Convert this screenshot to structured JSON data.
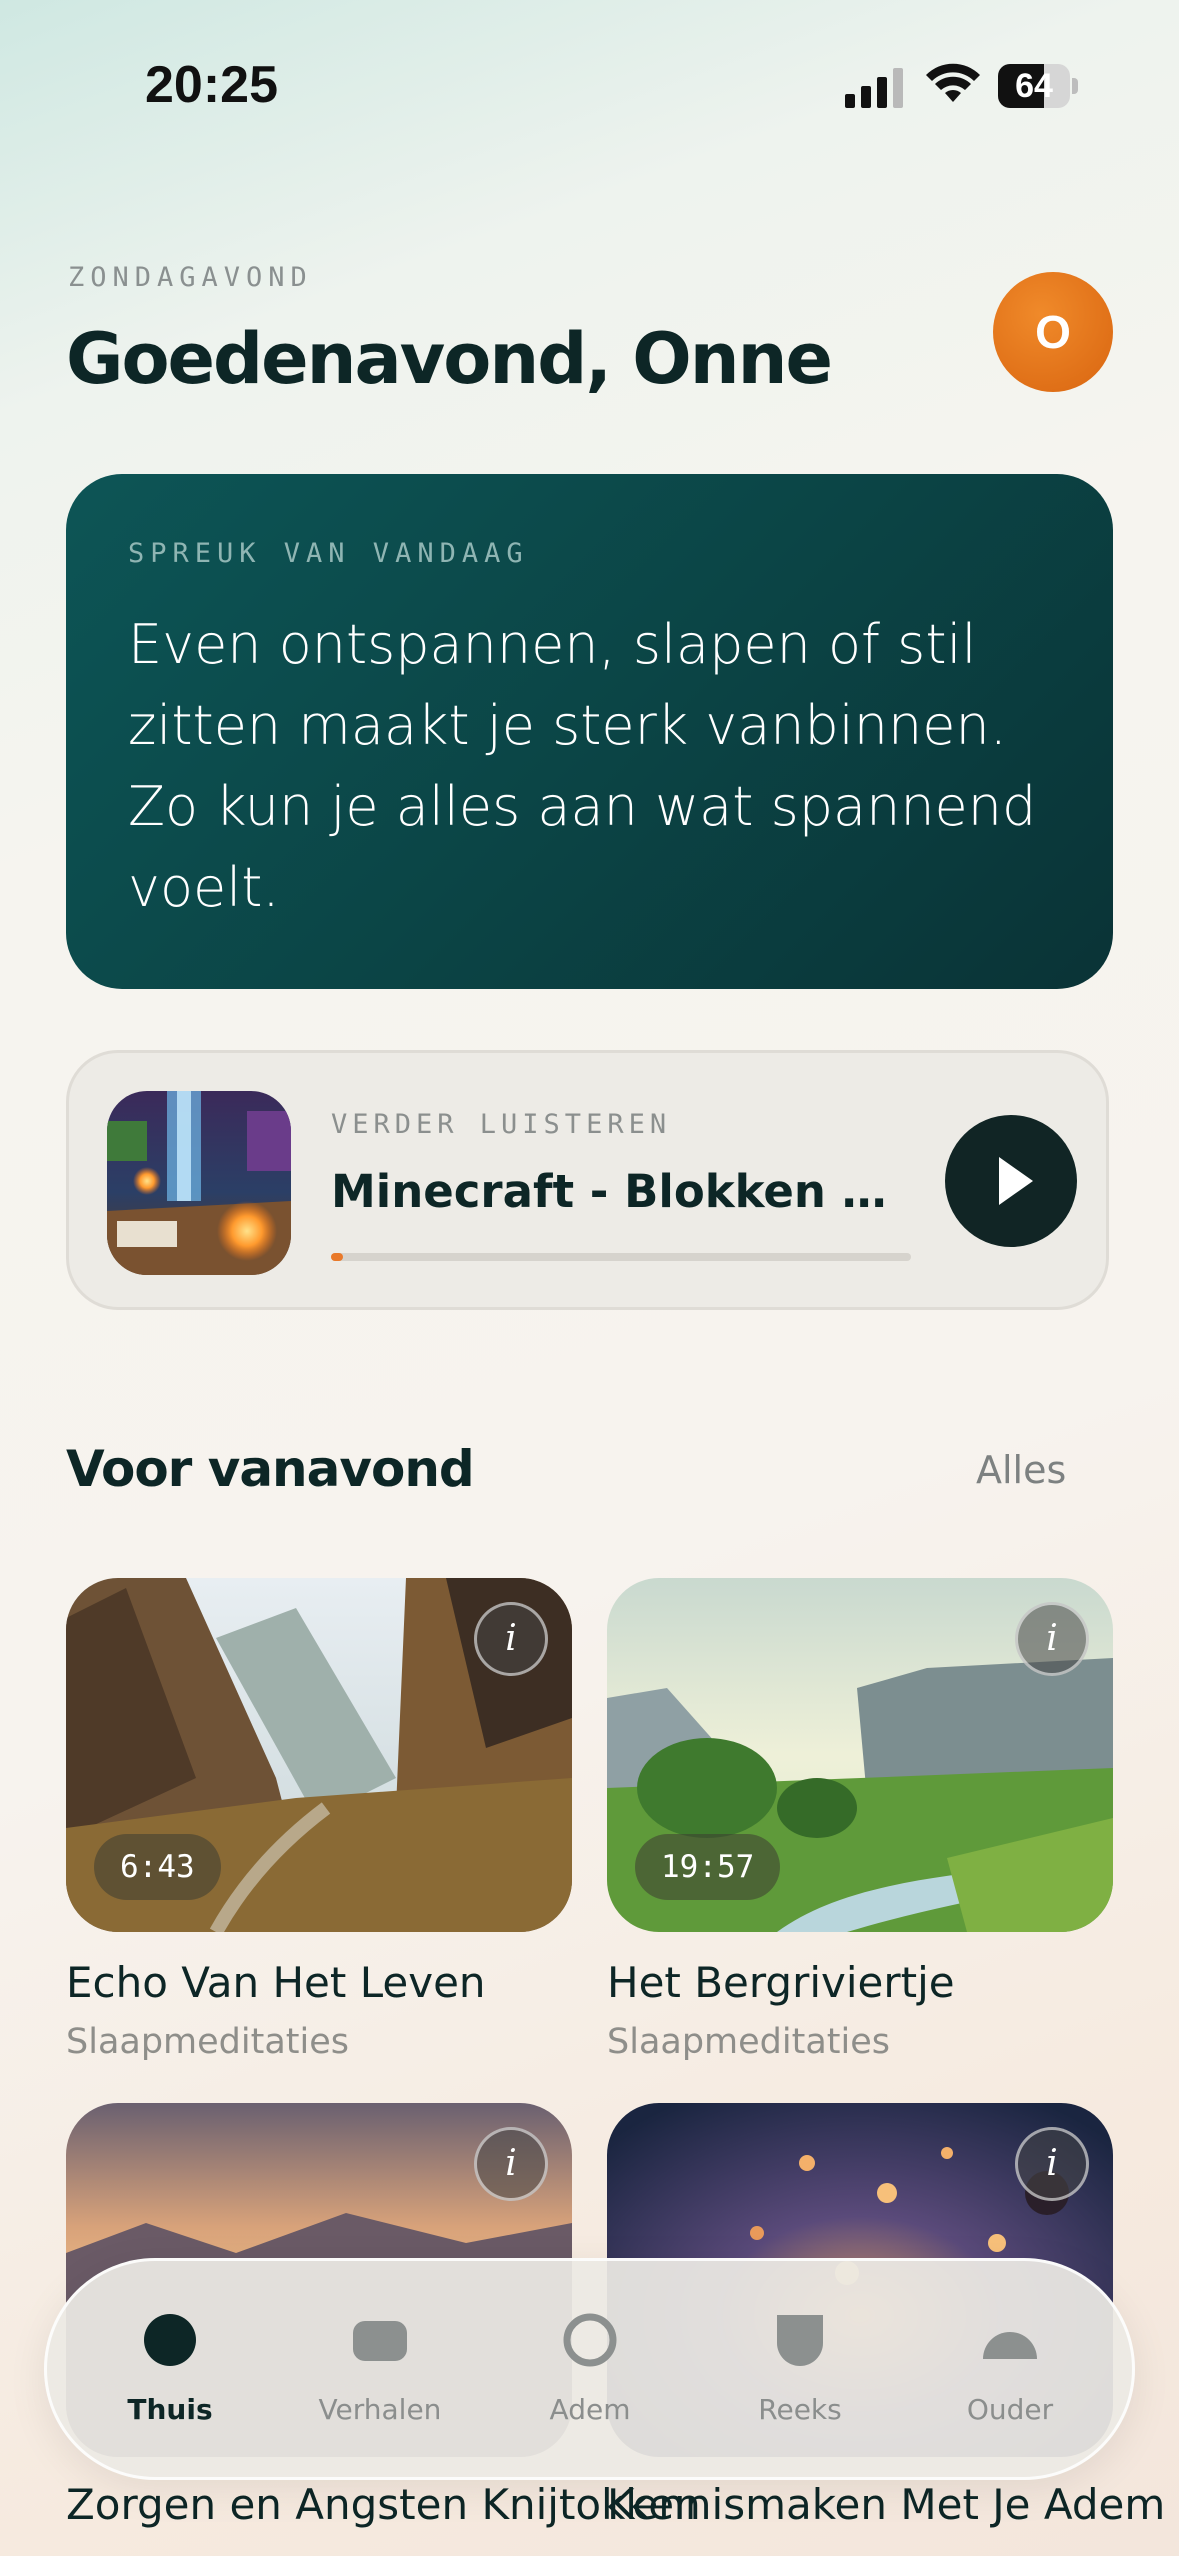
{
  "status_bar": {
    "time": "20:25",
    "battery": "64",
    "battery_level": 0.64
  },
  "header": {
    "day_label": "ZONDAGAVOND",
    "greeting": "Goedenavond, Onne",
    "avatar_initial": "O"
  },
  "quote": {
    "label": "SPREUK VAN VANDAAG",
    "text": "Even ontspannen, slapen of stil zitten maakt je sterk vanbinnen. Zo kun je alles aan wat spannend voelt."
  },
  "continue_listening": {
    "label": "VERDER LUISTEREN",
    "title": "Minecraft - Blokken Van Licht",
    "progress": 0.02
  },
  "section": {
    "title": "Voor vanavond",
    "see_all": "Alles"
  },
  "tiles": [
    {
      "title": "Echo Van Het Leven",
      "category": "Slaapmeditaties",
      "duration": "6:43",
      "info": "i"
    },
    {
      "title": "Het Bergriviertje",
      "category": "Slaapmeditaties",
      "duration": "19:57",
      "info": "i"
    },
    {
      "title": "Zorgen en Angsten Knijtokken",
      "category": "",
      "duration": "",
      "info": "i"
    },
    {
      "title": "Kennismaken Met Je Adem",
      "category": "",
      "duration": "",
      "info": "i"
    }
  ],
  "tabbar": {
    "items": [
      {
        "label": "Thuis",
        "active": true
      },
      {
        "label": "Verhalen",
        "active": false
      },
      {
        "label": "Adem",
        "active": false
      },
      {
        "label": "Reeks",
        "active": false
      },
      {
        "label": "Ouder",
        "active": false
      }
    ]
  },
  "colors": {
    "accent": "#e9792a",
    "card_teal": "#0b4546",
    "ink": "#0d2626"
  }
}
